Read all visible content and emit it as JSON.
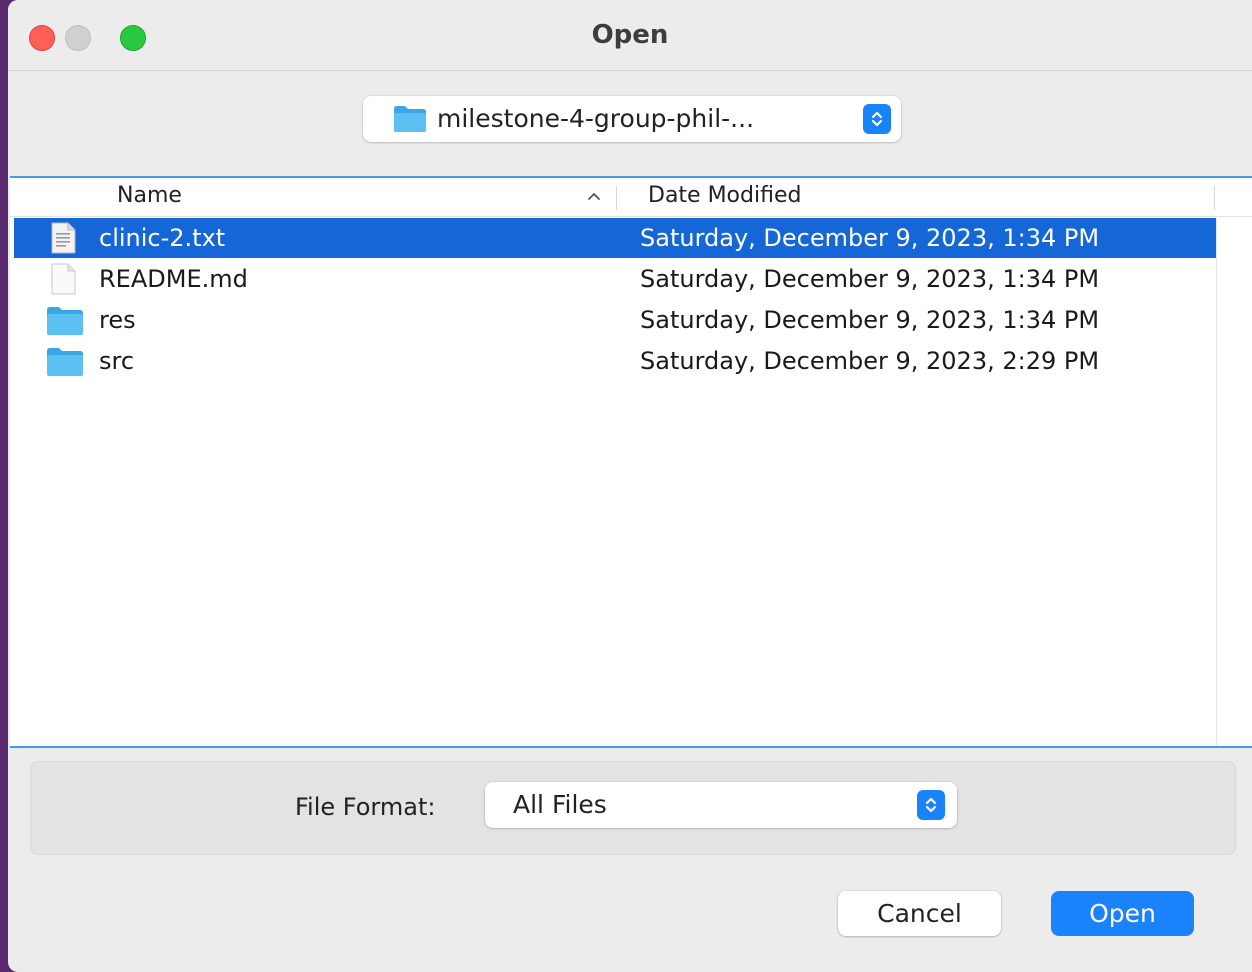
{
  "window": {
    "title": "Open"
  },
  "path_popup": {
    "label": "milestone-4-group-phil-...",
    "icon": "folder-icon"
  },
  "columns": {
    "name": "Name",
    "date_modified": "Date Modified"
  },
  "files": [
    {
      "name": "clinic-2.txt",
      "date": "Saturday, December 9, 2023, 1:34 PM",
      "type": "text-file",
      "selected": true
    },
    {
      "name": "README.md",
      "date": "Saturday, December 9, 2023, 1:34 PM",
      "type": "blank-file",
      "selected": false
    },
    {
      "name": "res",
      "date": "Saturday, December 9, 2023, 1:34 PM",
      "type": "folder",
      "selected": false
    },
    {
      "name": "src",
      "date": "Saturday, December 9, 2023, 2:29 PM",
      "type": "folder",
      "selected": false
    }
  ],
  "file_format": {
    "label": "File Format:",
    "value": "All Files"
  },
  "buttons": {
    "cancel": "Cancel",
    "open": "Open"
  },
  "colors": {
    "accent": "#1a82fb",
    "selection": "#1566d6",
    "folder": "#4fb7ee"
  }
}
